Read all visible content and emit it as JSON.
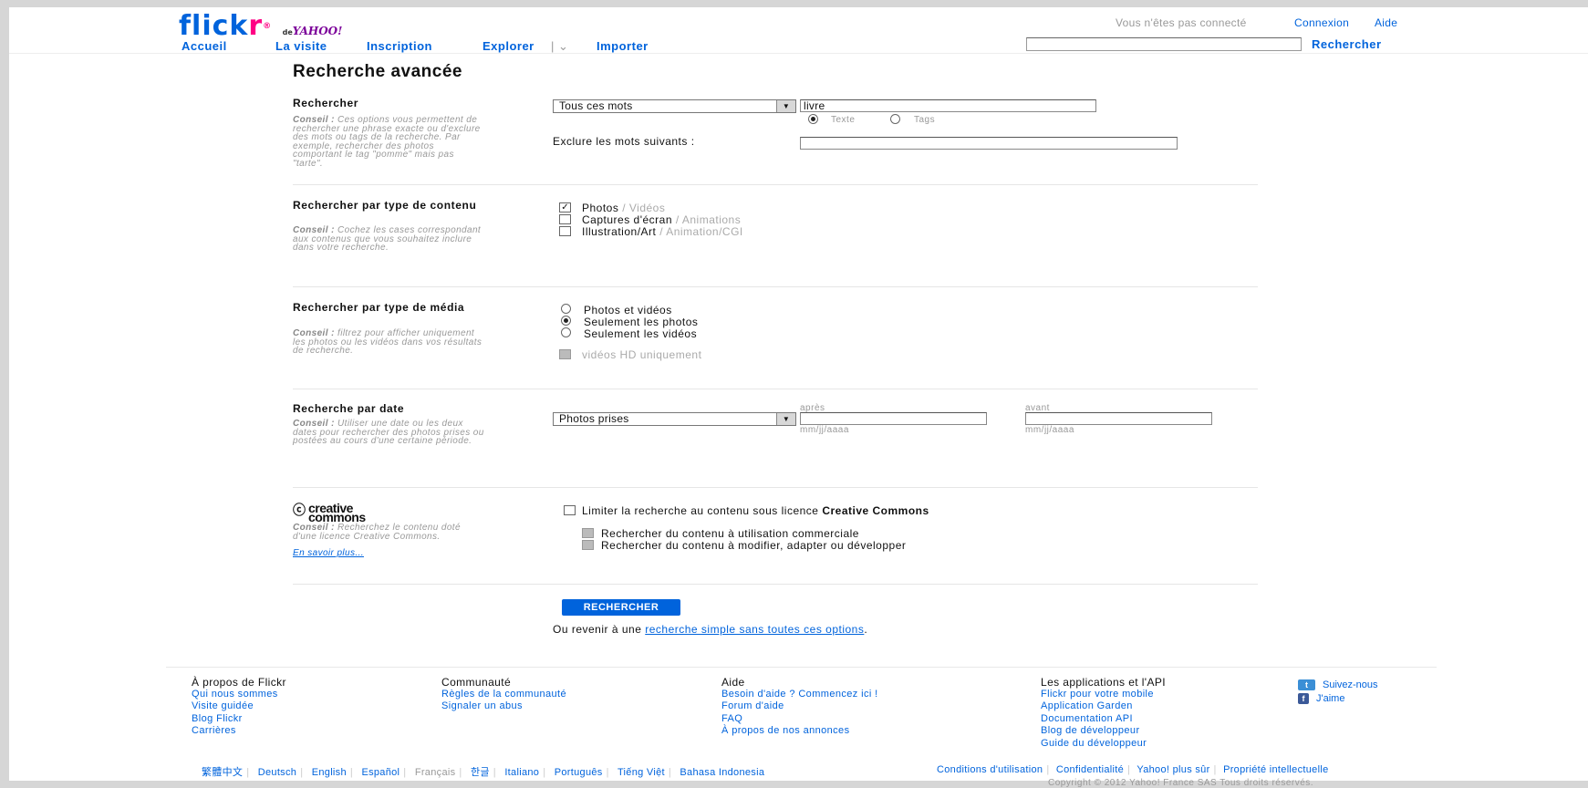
{
  "brand": {
    "logo_flick": "flick",
    "logo_r": "r",
    "logo_reg": "®",
    "logo_de": "de",
    "logo_yahoo": "YAHOO!"
  },
  "nav": [
    "Accueil",
    "La visite",
    "Inscription",
    "Explorer",
    "Importer"
  ],
  "top": {
    "status": "Vous n'êtes pas connecté",
    "login": "Connexion",
    "help": "Aide",
    "search_btn": "Rechercher",
    "search_value": ""
  },
  "title": "Recherche avancée",
  "s1": {
    "title": "Rechercher",
    "tip_label": "Conseil :",
    "tip": "Ces options vous permettent de rechercher une phrase exacte ou d'exclure des mots ou tags de la recherche. Par exemple, rechercher des photos comportant le tag \"pomme\" mais pas \"tarte\".",
    "mode": "Tous ces mots",
    "query": "livre",
    "radio_text": "Texte",
    "radio_tags": "Tags",
    "exclude_label": "Exclure les mots suivants :",
    "exclude_value": ""
  },
  "s2": {
    "title": "Rechercher par type de contenu",
    "tip_label": "Conseil :",
    "tip": "Cochez les cases correspondant aux contenus que vous souhaitez inclure dans votre recherche.",
    "options": [
      {
        "main": "Photos",
        "alt": "/ Vidéos",
        "checked": true
      },
      {
        "main": "Captures d'écran",
        "alt": "/ Animations",
        "checked": false
      },
      {
        "main": "Illustration/Art",
        "alt": "/ Animation/CGI",
        "checked": false
      }
    ]
  },
  "s3": {
    "title": "Rechercher par type de média",
    "tip_label": "Conseil :",
    "tip": "filtrez pour afficher uniquement les photos ou les vidéos dans vos résultats de recherche.",
    "options": [
      "Photos et vidéos",
      "Seulement les photos",
      "Seulement les vidéos"
    ],
    "hd": "vidéos HD uniquement"
  },
  "s4": {
    "title": "Recherche par date",
    "tip_label": "Conseil :",
    "tip": "Utiliser une date ou les deux dates pour rechercher des photos prises ou postées au cours d'une certaine période.",
    "mode": "Photos prises",
    "after_label": "après",
    "before_label": "avant",
    "format": "mm/jj/aaaa"
  },
  "s5": {
    "cc_logo_a": "creative",
    "cc_logo_b": "commons",
    "tip_label": "Conseil :",
    "tip": "Recherchez le contenu doté d'une licence Creative Commons.",
    "more": "En savoir plus...",
    "limit_a": "Limiter la recherche au contenu sous licence",
    "limit_b": "Creative Commons",
    "commercial": "Rechercher du contenu à utilisation commerciale",
    "modify": "Rechercher du contenu à modifier, adapter ou développer"
  },
  "submit": "RECHERCHER",
  "back_a": "Ou revenir à une",
  "back_link": "recherche simple sans toutes ces options",
  "back_b": ".",
  "footer": {
    "cols": [
      {
        "h": "À propos de Flickr",
        "links": [
          "Qui nous sommes",
          "Visite guidée",
          "Blog Flickr",
          "Carrières"
        ]
      },
      {
        "h": "Communauté",
        "links": [
          "Règles de la communauté",
          "Signaler un abus"
        ]
      },
      {
        "h": "Aide",
        "links": [
          "Besoin d'aide ? Commencez ici !",
          "Forum d'aide",
          "FAQ",
          "À propos de nos annonces"
        ]
      },
      {
        "h": "Les applications et l'API",
        "links": [
          "Flickr pour votre mobile",
          "Application Garden",
          "Documentation API",
          "Blog de développeur",
          "Guide du développeur"
        ]
      }
    ],
    "twitter": "Suivez-nous",
    "facebook": "J'aime",
    "langs": [
      "繁體中文",
      "Deutsch",
      "English",
      "Español",
      "Français",
      "한글",
      "Italiano",
      "Português",
      "Tiếng Việt",
      "Bahasa Indonesia"
    ],
    "legal": [
      "Conditions d'utilisation",
      "Confidentialité",
      "Yahoo! plus sûr",
      "Propriété intellectuelle"
    ],
    "copyright": "Copyright © 2012 Yahoo! France SAS Tous droits réservés."
  }
}
